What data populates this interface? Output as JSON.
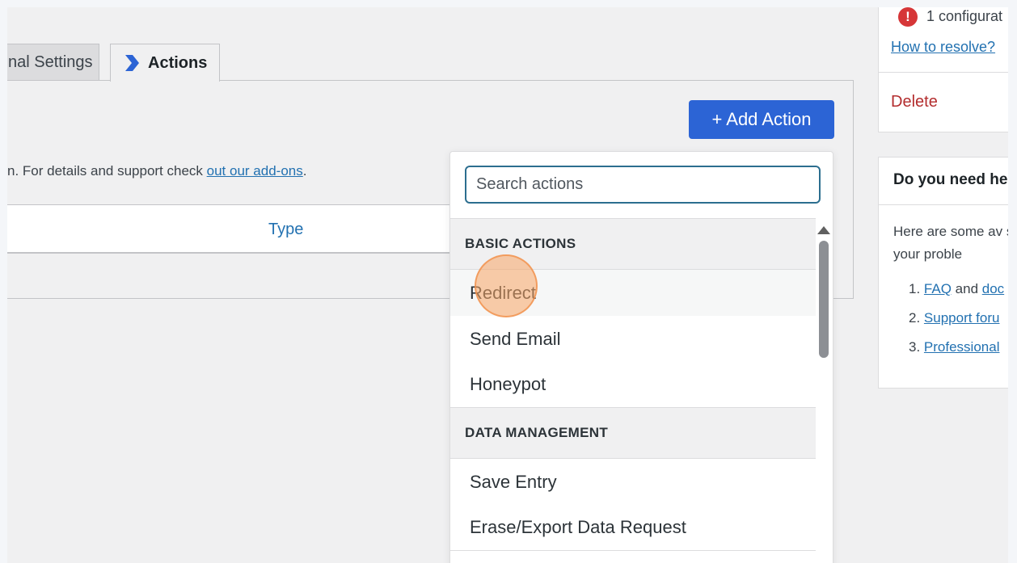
{
  "tabs": {
    "general_label": "nal Settings",
    "actions_label": "Actions"
  },
  "main": {
    "add_action_label": "+ Add Action",
    "description_prefix": "n. For details and support check ",
    "description_link": "out our add-ons",
    "description_suffix": ".",
    "type_header": "Type"
  },
  "dropdown": {
    "search_placeholder": "Search actions",
    "groups": [
      {
        "heading": "BASIC ACTIONS",
        "items": [
          "Redirect",
          "Send Email",
          "Honeypot"
        ]
      },
      {
        "heading": "DATA MANAGEMENT",
        "items": [
          "Save Entry",
          "Erase/Export Data Request"
        ]
      }
    ]
  },
  "sidebar": {
    "warning_icon": "!",
    "config_text": "1 configurat",
    "resolve_link": "How to resolve?",
    "delete_label": "Delete",
    "help_title": "Do you need he",
    "help_text": "Here are some av solve your proble",
    "help_items": [
      {
        "num": "1.",
        "link1": "FAQ",
        "mid": " and ",
        "link2": "doc"
      },
      {
        "num": "2.",
        "link1": "Support foru",
        "mid": "",
        "link2": ""
      },
      {
        "num": "3.",
        "link1": "Professional",
        "mid": "",
        "link2": ""
      }
    ]
  },
  "colors": {
    "primary_button": "#2c64d5",
    "link": "#2271b1",
    "delete": "#b32d2e",
    "warning": "#d63638"
  }
}
